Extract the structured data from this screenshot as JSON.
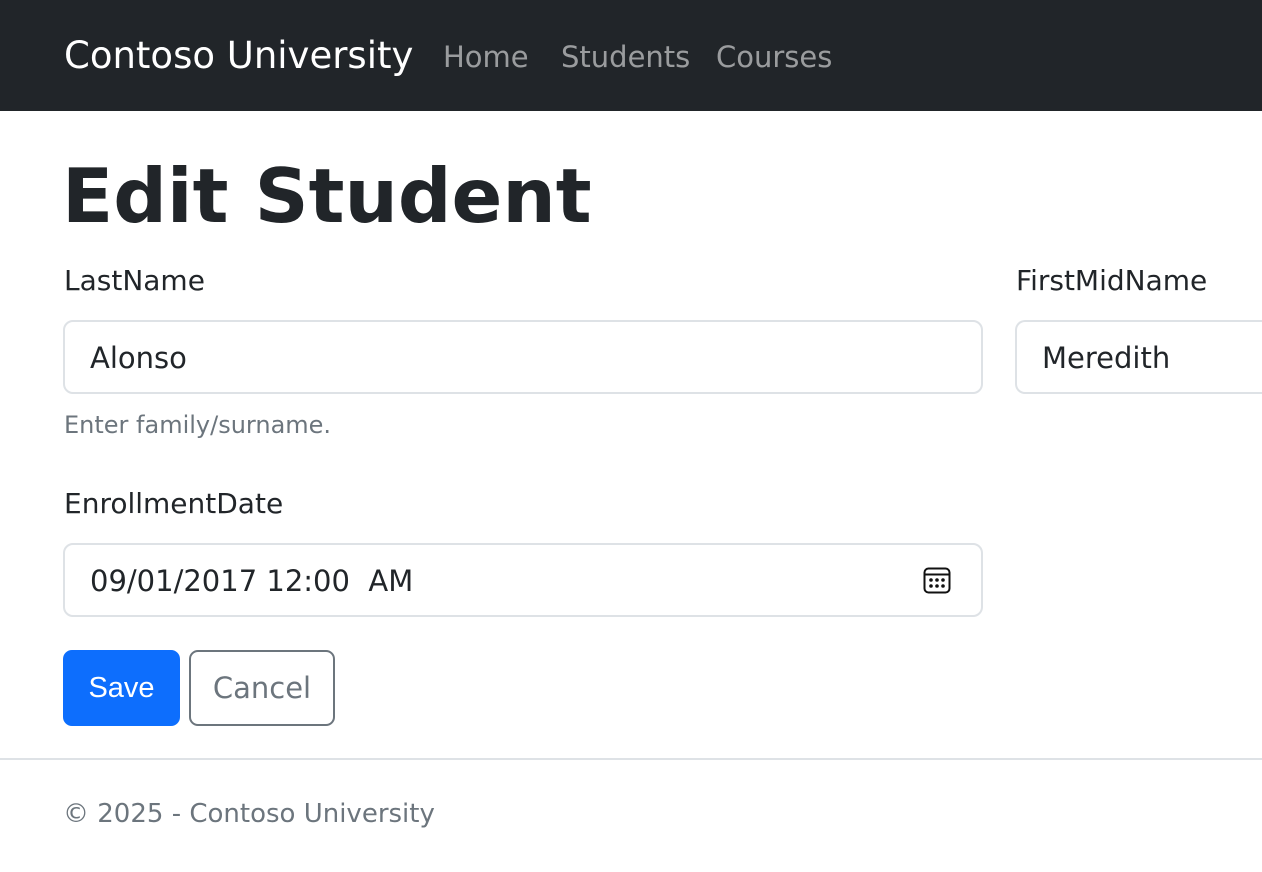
{
  "navbar": {
    "brand": "Contoso University",
    "links": [
      {
        "label": "Home"
      },
      {
        "label": "Students"
      },
      {
        "label": "Courses"
      }
    ]
  },
  "page": {
    "title": "Edit Student"
  },
  "form": {
    "last_name": {
      "label": "LastName",
      "value": "Alonso",
      "help": "Enter family/surname."
    },
    "first_mid_name": {
      "label": "FirstMidName",
      "value": "Meredith"
    },
    "enrollment_date": {
      "label": "EnrollmentDate",
      "value": "09/01/2017 12:00  AM",
      "icon": "calendar-icon"
    },
    "buttons": {
      "save": "Save",
      "cancel": "Cancel"
    }
  },
  "footer": {
    "text": "© 2025 - Contoso University"
  },
  "colors": {
    "navbar_bg": "#212529",
    "primary": "#0d6efd",
    "secondary": "#6c757d",
    "border": "#dee2e6"
  }
}
